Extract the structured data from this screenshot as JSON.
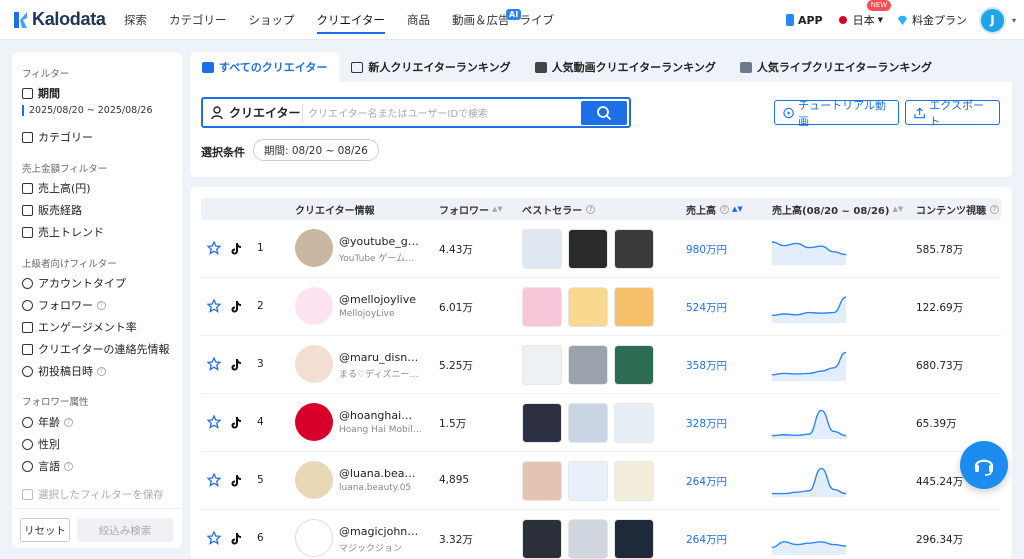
{
  "brand": {
    "name": "Kalodata",
    "accent": "#1d6fe8"
  },
  "nav": {
    "items": [
      "探索",
      "カテゴリー",
      "ショップ",
      "クリエイター",
      "商品",
      "動画＆広告",
      "ライブ"
    ],
    "active": "クリエイター",
    "ai_badge": "AI",
    "app": "APP",
    "language": "日本",
    "new_badge": "NEW",
    "plan": "料金プラン",
    "user_initial": "J"
  },
  "sidebar": {
    "filter_title": "フィルター",
    "period_label": "期間",
    "period_value": "2025/08/20 ~ 2025/08/26",
    "category": "カテゴリー",
    "sales_filter_title": "売上金額フィルター",
    "sales_amount": "売上高(円)",
    "channel": "販売経路",
    "sales_trend": "売上トレンド",
    "advanced_title": "上級者向けフィルター",
    "account_type": "アカウントタイプ",
    "follower": "フォロワー",
    "engagement": "エンゲージメント率",
    "contact": "クリエイターの連絡先情報",
    "first_post": "初投稿日時",
    "follower_attr_title": "フォロワー属性",
    "age": "年齢",
    "gender": "性別",
    "language": "言語",
    "save_filter": "選択したフィルターを保存",
    "reset": "リセット",
    "apply": "絞込み検索"
  },
  "tabs": [
    "すべてのクリエイター",
    "新人クリエイターランキング",
    "人気動画クリエイターランキング",
    "人気ライブクリエイターランキング"
  ],
  "search": {
    "label": "クリエイター",
    "placeholder": "クリエイター名またはユーザーIDで検索"
  },
  "buttons": {
    "tutorial": "チュートリアル動画",
    "export": "エクスポート"
  },
  "conditions": {
    "label": "選択条件",
    "period_chip": "期間: 08/20 ~ 08/26"
  },
  "table": {
    "headers": {
      "creator": "クリエイター情報",
      "followers": "フォロワー",
      "bestseller": "ベストセラー",
      "sales": "売上高",
      "sales_trend": "売上高(08/20 ~ 08/26)",
      "views": "コンテンツ視聴"
    },
    "rows": [
      {
        "rank": "1",
        "handle": "@youtube_g…",
        "subname": "YouTube ゲーム仮面",
        "followers": "4.43万",
        "sales": "980万円",
        "views": "585.78万",
        "trend": [
          0.75,
          0.62,
          0.7,
          0.55,
          0.6,
          0.4,
          0.3
        ]
      },
      {
        "rank": "2",
        "handle": "@mellojoylive",
        "subname": "MellojoyLive",
        "followers": "6.01万",
        "sales": "524万円",
        "views": "122.69万",
        "trend": [
          0.2,
          0.25,
          0.22,
          0.3,
          0.28,
          0.3,
          0.85
        ]
      },
      {
        "rank": "3",
        "handle": "@maru_disn…",
        "subname": "まる♡ディズニー🫶💕",
        "followers": "5.25万",
        "sales": "358万円",
        "views": "680.73万",
        "trend": [
          0.15,
          0.2,
          0.18,
          0.2,
          0.28,
          0.4,
          0.95
        ]
      },
      {
        "rank": "4",
        "handle": "@hoanghaim…",
        "subname": "Hoang Hai Mobile…",
        "followers": "1.5万",
        "sales": "328万円",
        "views": "65.39万",
        "trend": [
          0.05,
          0.08,
          0.06,
          0.1,
          0.95,
          0.2,
          0.05
        ]
      },
      {
        "rank": "5",
        "handle": "@luana.beau…",
        "subname": "luana.beauty.05",
        "followers": "4,895",
        "sales": "264万円",
        "views": "445.24万",
        "trend": [
          0.05,
          0.05,
          0.1,
          0.15,
          0.95,
          0.2,
          0.05
        ]
      },
      {
        "rank": "6",
        "handle": "@magicjohn…",
        "subname": "マジックジョン",
        "followers": "3.32万",
        "sales": "264万円",
        "views": "296.34万",
        "trend": [
          0.2,
          0.4,
          0.3,
          0.35,
          0.4,
          0.3,
          0.25
        ]
      }
    ]
  }
}
